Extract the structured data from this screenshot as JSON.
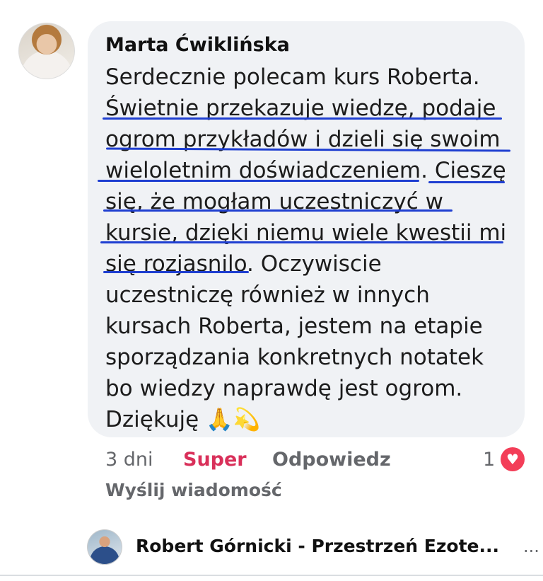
{
  "comment": {
    "author": "Marta Ćwiklińska",
    "lines": [
      "Serdecznie polecam kurs Roberta.",
      "Świetnie przekazuje wiedzę, podaje",
      "ogrom przykładów i dzieli się swoim",
      "wieloletnim doświadczeniem. Cieszę",
      "się, że mogłam uczestniczyć w",
      "kursie, dzięki niemu wiele kwestii mi",
      "się rozjasnilo. Oczywiscie",
      "uczestniczę również w innych",
      "kursach Roberta, jestem na etapie",
      "sporządzania konkretnych notatek",
      "bo wiedzy naprawdę jest ogrom.",
      "Dziękuję 🙏💫"
    ]
  },
  "actions": {
    "time": "3 dni",
    "super": "Super",
    "reply": "Odpowiedz",
    "reaction_count": "1",
    "reaction_icon": "♥"
  },
  "send_message": "Wyślij wiadomość",
  "reply_preview": {
    "author": "Robert Górnicki - Przestrzeń Ezote...",
    "more": "..."
  },
  "colors": {
    "bubble": "#f0f2f5",
    "super": "#d9305a",
    "underline": "#1f3fd1",
    "heart": "#f33e58"
  }
}
